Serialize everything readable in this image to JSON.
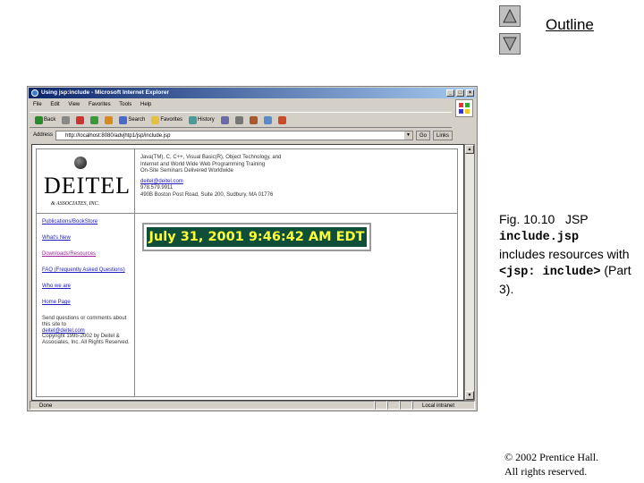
{
  "slide": {
    "outline_label": "Outline",
    "caption": {
      "fig_label": "Fig. 10.10",
      "text1": "JSP",
      "code1": "include.jsp",
      "text2": "includes resources with",
      "code2": "<jsp: include>",
      "text3": "(Part 3)."
    },
    "copyright_line1": "© 2002 Prentice Hall.",
    "copyright_line2": "All rights reserved."
  },
  "browser": {
    "title": "Using jsp:include - Microsoft Internet Explorer",
    "menu": [
      "File",
      "Edit",
      "View",
      "Favorites",
      "Tools",
      "Help"
    ],
    "toolbar": {
      "back": "Back",
      "search": "Search",
      "favorites": "Favorites",
      "history": "History"
    },
    "address_label": "Address",
    "address_value": "http://localhost:8080/advjhtp1/jsp/include.jsp",
    "go_label": "Go",
    "links_label": "Links",
    "status_text": "Done",
    "zone_text": "Local intranet"
  },
  "page": {
    "logo_text": "DEITEL",
    "logo_sub": "& ASSOCIATES, INC.",
    "header_lines": [
      "Java(TM), C, C++, Visual Basic(R), Object Technology, and",
      "Internet and World Wide Web Programming Training",
      "On-Site Seminars Delivered Worldwide"
    ],
    "header_email": "deitel@deitel.com",
    "header_phone": "978.579.9911",
    "header_address": "490B Boston Post Road, Suite 200, Sudbury, MA 01776",
    "nav_links": [
      "Publications/BookStore",
      "What's New",
      "Downloads/Resources",
      "FAQ (Frequently Asked Questions)",
      "Who we are",
      "Home Page"
    ],
    "footer_text": "Send questions or comments about this site to",
    "footer_email": "deitel@deitel.com",
    "footer_copyright": "Copyright 1995-2002 by Deitel & Associates, Inc. All Rights Reserved.",
    "clock_text": "July 31, 2001 9:46:42 AM EDT"
  }
}
